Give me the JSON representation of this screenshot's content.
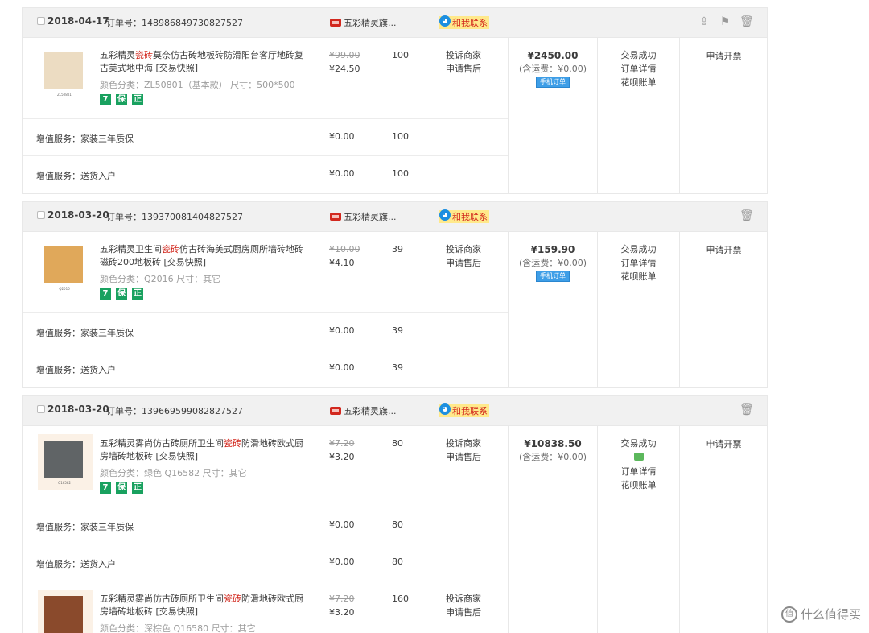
{
  "orders": [
    {
      "date": "2018-04-17",
      "order_no": "订单号：148986849730827527",
      "shop": "五彩精灵旗...",
      "contact": "和我联系",
      "item": {
        "title_pre": "五彩精灵",
        "title_hl": "瓷砖",
        "title_post": "莫奈仿古砖地板砖防滑阳台客厅地砖复古美式地中海 [交易快照]",
        "attr": "颜色分类：ZL50801（基本款） 尺寸：500*500",
        "tile_label": "ZL50801",
        "price_old": "¥99.00",
        "price_now": "¥24.50",
        "qty": "100",
        "ops": [
          "投诉商家",
          "申请售后"
        ]
      },
      "services": [
        {
          "label": "增值服务：家装三年质保",
          "price": "¥0.00",
          "qty": "100"
        },
        {
          "label": "增值服务：送货入户",
          "price": "¥0.00",
          "qty": "100"
        }
      ],
      "total": "¥2450.00",
      "ship": "(含运费：¥0.00)",
      "mobile_tag": "手机订单",
      "status": [
        "交易成功",
        "订单详情",
        "花呗账单"
      ],
      "invoice": "申请开票"
    },
    {
      "date": "2018-03-20",
      "order_no": "订单号：139370081404827527",
      "shop": "五彩精灵旗...",
      "contact": "和我联系",
      "item": {
        "title_pre": "五彩精灵卫生间",
        "title_hl": "瓷砖",
        "title_post": "仿古砖海美式厨房厕所墙砖地砖磁砖200地板砖 [交易快照]",
        "attr": "颜色分类：Q2016 尺寸：其它",
        "tile_label": "Q2016",
        "price_old": "¥10.00",
        "price_now": "¥4.10",
        "qty": "39",
        "ops": [
          "投诉商家",
          "申请售后"
        ]
      },
      "services": [
        {
          "label": "增值服务：家装三年质保",
          "price": "¥0.00",
          "qty": "39"
        },
        {
          "label": "增值服务：送货入户",
          "price": "¥0.00",
          "qty": "39"
        }
      ],
      "total": "¥159.90",
      "ship": "(含运费：¥0.00)",
      "mobile_tag": "手机订单",
      "status": [
        "交易成功",
        "订单详情",
        "花呗账单"
      ],
      "invoice": "申请开票"
    },
    {
      "date": "2018-03-20",
      "order_no": "订单号：139669599082827527",
      "shop": "五彩精灵旗...",
      "contact": "和我联系",
      "item": {
        "title_pre": "五彩精灵雾尚仿古砖厕所卫生间",
        "title_hl": "瓷砖",
        "title_post": "防滑地砖欧式厨房墙砖地板砖 [交易快照]",
        "attr": "颜色分类：绿色 Q16582 尺寸：其它",
        "tile_label": "Q16582",
        "price_old": "¥7.20",
        "price_now": "¥3.20",
        "qty": "80",
        "ops": [
          "投诉商家",
          "申请售后"
        ]
      },
      "services": [
        {
          "label": "增值服务：家装三年质保",
          "price": "¥0.00",
          "qty": "80"
        },
        {
          "label": "增值服务：送货入户",
          "price": "¥0.00",
          "qty": "80"
        }
      ],
      "item2": {
        "title_pre": "五彩精灵雾尚仿古砖厕所卫生间",
        "title_hl": "瓷砖",
        "title_post": "防滑地砖欧式厨房墙砖地板砖 [交易快照]",
        "attr": "颜色分类：深棕色 Q16580 尺寸：其它",
        "price_old": "¥7.20",
        "price_now": "¥3.20",
        "qty": "160",
        "ops": [
          "投诉商家",
          "申请售后"
        ]
      },
      "total": "¥10838.50",
      "ship": "(含运费：¥0.00)",
      "status": [
        "交易成功",
        "订单详情",
        "花呗账单"
      ],
      "invoice": "申请开票"
    }
  ],
  "badges": [
    "7",
    "保",
    "正"
  ],
  "watermark": "什么值得买",
  "colors": {
    "highlight": "#d2281e",
    "badge": "#19a15f",
    "header_bg": "#f1f1f1"
  }
}
